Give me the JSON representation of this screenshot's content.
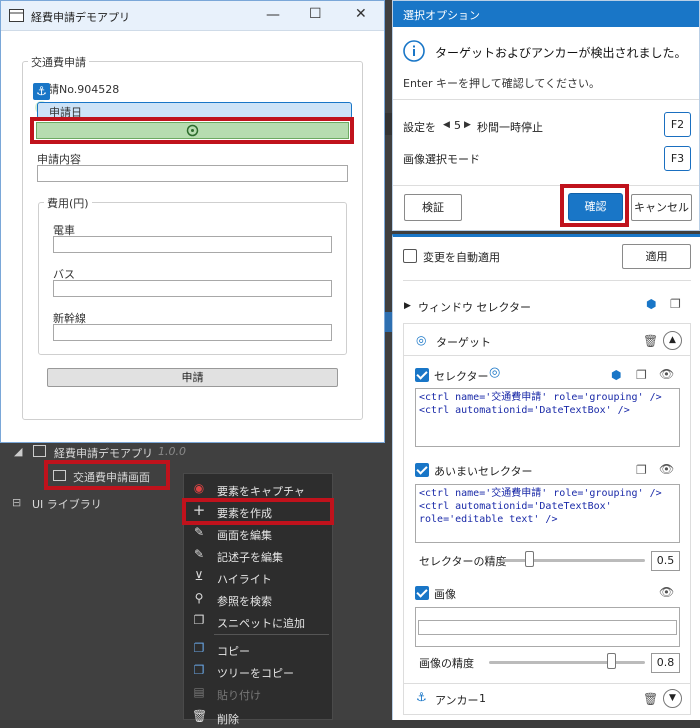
{
  "app": {
    "title": "経費申請デモアプリ",
    "group_label": "交通費申請",
    "request_no": "申請No.904528",
    "date_label": "申請日",
    "content_label": "申請内容",
    "expense_group": "費用(円)",
    "train_label": "電車",
    "bus_label": "バス",
    "shinkansen_label": "新幹線",
    "submit_label": "申請"
  },
  "tree": {
    "app_node": "経費申請デモアプリ",
    "app_version": "1.0.0",
    "screen_node": "交通費申請画面",
    "library_node": "UI ライブラリ"
  },
  "context_menu": {
    "items": [
      "要素をキャプチャ",
      "要素を作成",
      "画面を編集",
      "記述子を編集",
      "ハイライト",
      "参照を検索",
      "スニペットに追加",
      "コピー",
      "ツリーをコピー",
      "貼り付け",
      "削除"
    ]
  },
  "options": {
    "title": "選択オプション",
    "message": "ターゲットおよびアンカーが検出されました。",
    "hint": "Enter キーを押して確認してください。",
    "pause_prefix": "設定を",
    "pause_value": "5",
    "pause_suffix": "秒間一時停止",
    "pause_key": "F2",
    "image_mode_label": "画像選択モード",
    "image_mode_key": "F3",
    "validate_label": "検証",
    "confirm_label": "確認",
    "cancel_label": "キャンセル"
  },
  "props": {
    "auto_apply_label": "変更を自動適用",
    "apply_label": "適用",
    "window_selector_label": "ウィンドウ セレクター",
    "target_label": "ターゲット",
    "selector_label": "セレクター",
    "selector_code": "<ctrl name='交通費申請' role='grouping' />\n<ctrl automationid='DateTextBox' />",
    "fuzzy_label": "あいまいセレクター",
    "fuzzy_code": "<ctrl name='交通費申請' role='grouping' />\n<ctrl automationid='DateTextBox'\nrole='editable text' />",
    "fuzzy_accuracy_label": "セレクターの精度",
    "fuzzy_accuracy_value": "0.5",
    "image_label": "画像",
    "image_accuracy_label": "画像の精度",
    "image_accuracy_value": "0.8",
    "anchor_label": "アンカー",
    "anchor_count": "1",
    "fuzzy_accuracy": 0.5,
    "image_accuracy": 0.8
  },
  "colors": {
    "accent": "#1976c7",
    "highlight": "#c0121c",
    "target_fill": "#b6dcb0"
  }
}
